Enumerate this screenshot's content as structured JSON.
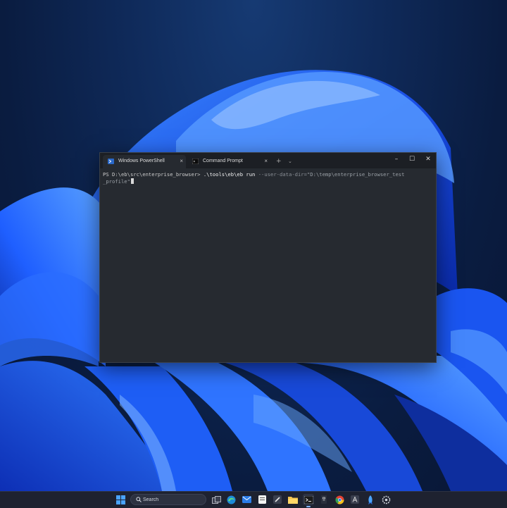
{
  "terminal": {
    "tabs": [
      {
        "label": "Windows PowerShell",
        "icon": "powershell-icon",
        "active": true
      },
      {
        "label": "Command Prompt",
        "icon": "command-prompt-icon",
        "active": false
      }
    ],
    "new_tab_glyph": "+",
    "dropdown_glyph": "⌄",
    "close_glyph": "×",
    "window_controls": {
      "minimize": "–",
      "maximize": "☐",
      "close": "✕"
    },
    "prompt": "PS D:\\eb\\src\\enterprise_browser> ",
    "command": ".\\tools\\eb\\eb run",
    "argument": " --user-data-dir=",
    "path_line1": "\"D:\\temp\\enterprise_browser_test",
    "path_line2": "_profile\""
  },
  "taskbar": {
    "search_placeholder": "Search",
    "pinned": [
      "start-icon",
      "task-view-icon",
      "edge-icon",
      "mail-icon",
      "notes-icon",
      "solitaire-icon",
      "file-explorer-icon",
      "terminal-icon",
      "app-icon",
      "chrome-icon",
      "font-app-icon",
      "rocket-app-icon",
      "settings-icon"
    ],
    "active_app": "terminal-icon"
  },
  "colors": {
    "terminal_bg": "#262a30",
    "titlebar_bg": "#1c1f24",
    "taskbar_bg": "#1e2230",
    "accent": "#1f5fff"
  }
}
